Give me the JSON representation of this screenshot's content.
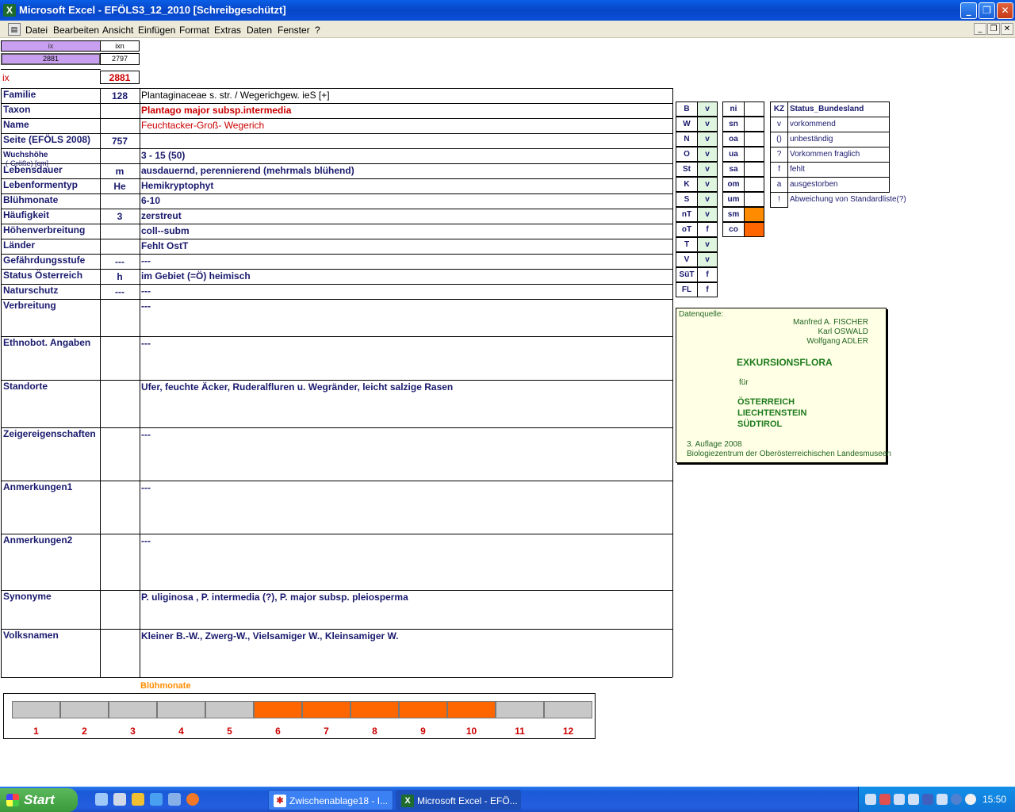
{
  "window": {
    "title": "Microsoft Excel - EFÖLS3_12_2010  [Schreibgeschützt]"
  },
  "menu": [
    "Datei",
    "Bearbeiten",
    "Ansicht",
    "Einfügen",
    "Format",
    "Extras",
    "Daten",
    "Fenster",
    "?"
  ],
  "top": {
    "ix_header": "ix",
    "ixn_header": "ixn",
    "ix_value": "2881",
    "ixn_value": "2797",
    "ix_label": "ix",
    "ix_big": "2881"
  },
  "rows": [
    {
      "label": "Familie",
      "code": "128",
      "value": "Plantaginaceae s. str.  /  Wegerichgew. ieS [+]"
    },
    {
      "label": "Taxon",
      "code": "",
      "value": "Plantago major subsp.intermedia"
    },
    {
      "label": "Name",
      "code": "",
      "value": "Feuchtacker-Groß- Wegerich"
    },
    {
      "label": "Seite (EFÖLS 2008)",
      "code": "757",
      "value": ""
    },
    {
      "label": "Wuchshöhe",
      "label_small": "(-Größe) [cm]",
      "code": "",
      "value": " 3 - 15 (50)"
    },
    {
      "label": "Lebensdauer",
      "code": "m",
      "value": "ausdauernd, perennierend (mehrmals blühend)"
    },
    {
      "label": "Lebenformentyp",
      "code": "He",
      "value": "Hemikryptophyt"
    },
    {
      "label": "Blühmonate",
      "code": "",
      "value": " 6-10"
    },
    {
      "label": "Häufigkeit",
      "code": "3",
      "value": "zerstreut"
    },
    {
      "label": "Höhenverbreitung",
      "code": "",
      "value": "coll--subm"
    },
    {
      "label": "Länder",
      "code": "",
      "value": "Fehlt OstT"
    },
    {
      "label": "Gefährdungsstufe",
      "code": "---",
      "value": "  ---"
    },
    {
      "label": "Status Österreich",
      "code": "h",
      "value": "im Gebiet (=Ö) heimisch"
    },
    {
      "label": "Naturschutz",
      "code": "---",
      "value": " ---"
    },
    {
      "label": "Verbreitung",
      "code": "",
      "value": " ---"
    },
    {
      "label": "Ethnobot. Angaben",
      "code": "",
      "value": "---"
    },
    {
      "label": "Standorte",
      "code": "",
      "value": "Ufer, feuchte Äcker, Ruderalfluren u. Wegränder, leicht salzige Rasen"
    },
    {
      "label": "Zeigereigenschaften",
      "code": "",
      "value": "---"
    },
    {
      "label": "Anmerkungen1",
      "code": "",
      "value": "---"
    },
    {
      "label": "Anmerkungen2",
      "code": "",
      "value": "---"
    },
    {
      "label": "Synonyme",
      "code": "",
      "value": "P. uliginosa , P. intermedia (?), P. major subsp. pleiosperma"
    },
    {
      "label": "Volksnamen",
      "code": "",
      "value": "Kleiner B.-W.,  Zwerg-W., Vielsamiger W., Kleinsamiger W."
    }
  ],
  "states1": [
    {
      "code": "B",
      "val": "v"
    },
    {
      "code": "W",
      "val": "v"
    },
    {
      "code": "N",
      "val": "v"
    },
    {
      "code": "O",
      "val": "v"
    },
    {
      "code": "St",
      "val": "v"
    },
    {
      "code": "K",
      "val": "v"
    },
    {
      "code": "S",
      "val": "v"
    },
    {
      "code": "nT",
      "val": "v"
    },
    {
      "code": "oT",
      "val": "f"
    },
    {
      "code": "T",
      "val": "v"
    },
    {
      "code": "V",
      "val": "v"
    },
    {
      "code": "SüT",
      "val": "f"
    },
    {
      "code": "FL",
      "val": "f"
    }
  ],
  "states2": [
    {
      "code": "ni",
      "val": ""
    },
    {
      "code": "sn",
      "val": ""
    },
    {
      "code": "oa",
      "val": ""
    },
    {
      "code": "ua",
      "val": ""
    },
    {
      "code": "sa",
      "val": ""
    },
    {
      "code": "om",
      "val": ""
    },
    {
      "code": "um",
      "val": ""
    },
    {
      "code": "sm",
      "val": "",
      "color": "#ff8c00"
    },
    {
      "code": "co",
      "val": "",
      "color": "#ff6600"
    }
  ],
  "legend": {
    "header_kz": "KZ",
    "header_status": "Status_Bundesland",
    "items": [
      {
        "kz": "v",
        "text": "vorkommend"
      },
      {
        "kz": "()",
        "text": "unbeständig"
      },
      {
        "kz": "?",
        "text": "Vorkommen fraglich"
      },
      {
        "kz": "f",
        "text": "fehlt"
      },
      {
        "kz": "a",
        "text": "ausgestorben"
      },
      {
        "kz": "!",
        "text": "Abweichung von Standardliste(?)"
      }
    ]
  },
  "source": {
    "heading": "Datenquelle:",
    "authors": [
      "Manfred A. FISCHER",
      "Karl OSWALD",
      "Wolfgang ADLER"
    ],
    "title": "EXKURSIONSFLORA",
    "fuer": "für",
    "countries": [
      "ÖSTERREICH",
      "LIECHTENSTEIN",
      "SÜDTIROL"
    ],
    "edition": "3. Auflage 2008",
    "publisher": "Biologiezentrum der Oberösterreichischen Landesmuseen"
  },
  "bloom": {
    "title": "Blühmonate",
    "months": [
      "1",
      "2",
      "3",
      "4",
      "5",
      "6",
      "7",
      "8",
      "9",
      "10",
      "11",
      "12"
    ],
    "active": [
      false,
      false,
      false,
      false,
      false,
      true,
      true,
      true,
      true,
      true,
      false,
      false
    ],
    "on_color": "#ff6600",
    "off_color": "#c8c8c8"
  },
  "taskbar": {
    "start": "Start",
    "tasks": [
      "Zwischenablage18 - I...",
      "Microsoft Excel - EFÖ..."
    ],
    "clock": "15:50"
  }
}
